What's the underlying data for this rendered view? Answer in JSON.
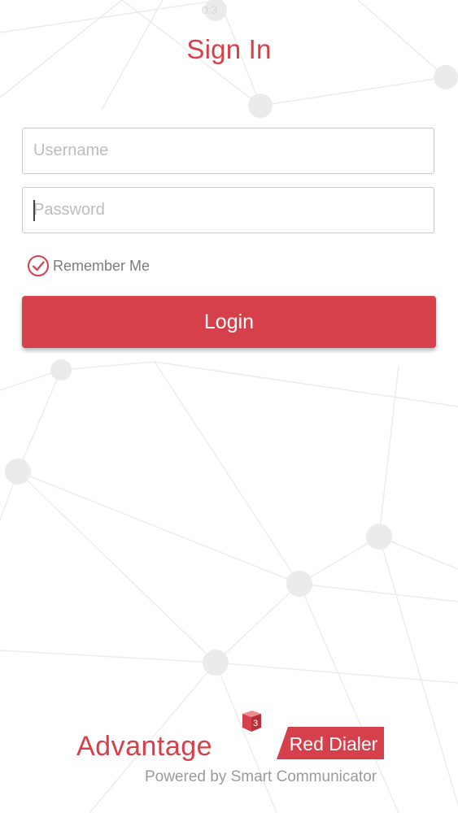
{
  "app": {
    "title": "Sign In",
    "status_time": "0:3"
  },
  "form": {
    "username_placeholder": "Username",
    "password_placeholder": "Password",
    "remember_label": "Remember Me",
    "remember_checked": true,
    "login_label": "Login"
  },
  "footer": {
    "brand_name": "Advantage",
    "brand_superscript": "3",
    "product_name": "Red Dialer",
    "powered_by": "Powered by Smart Communicator"
  },
  "colors": {
    "accent": "#d6404b",
    "background": "#ffffff",
    "muted_text": "#9a9a9a"
  },
  "icons": {
    "remember": "check-circle-icon",
    "brand_cube": "cube-icon"
  }
}
